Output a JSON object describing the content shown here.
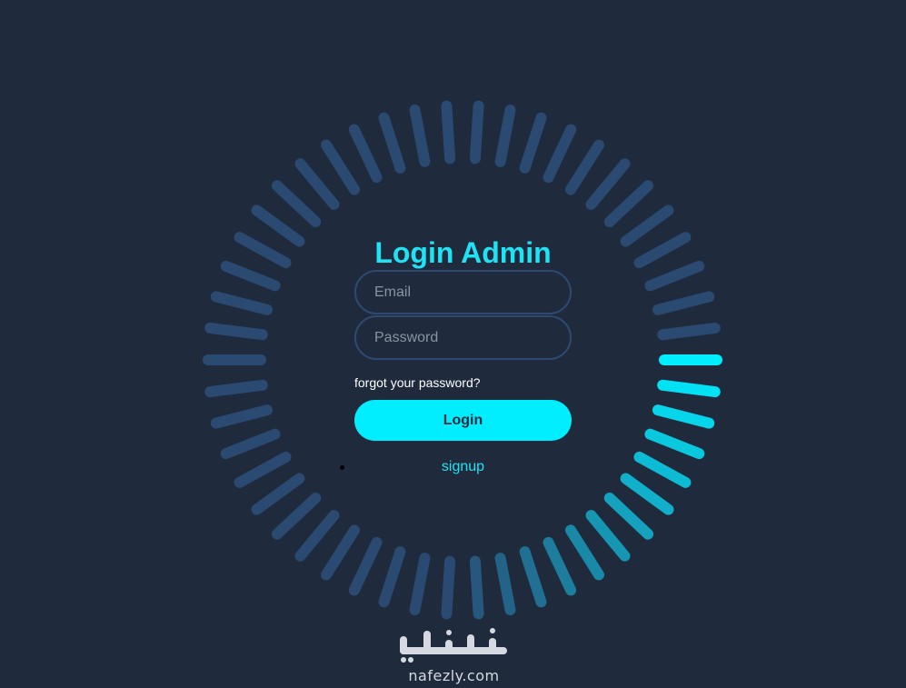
{
  "title": "Login Admin",
  "email": {
    "placeholder": "Email"
  },
  "password": {
    "placeholder": "Password"
  },
  "forgot_link": "forgot your password?",
  "login_button": "Login",
  "signup_link": "signup",
  "watermark": {
    "arabic": "نفذلي",
    "latin": "nafezly.com"
  },
  "colors": {
    "background": "#1f2a3c",
    "accent": "#00eeff",
    "ring_idle": "#2b4a72",
    "field_border": "#2e4a70"
  },
  "spinner": {
    "segment_count": 50,
    "active_index": 0
  }
}
